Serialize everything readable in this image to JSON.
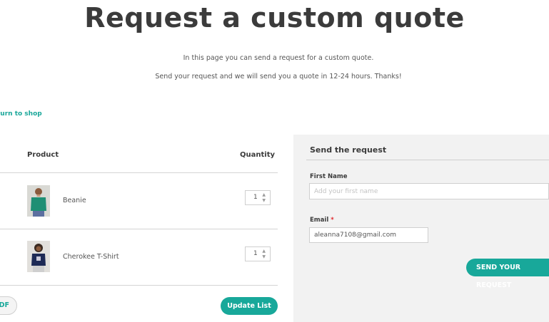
{
  "page": {
    "title": "Request a custom quote",
    "intro_line_1": "In this page you can send a request for a custom quote.",
    "intro_line_2": "Send your request and we will send you a quote in 12-24 hours. Thanks!",
    "return_link": "turn to shop"
  },
  "table": {
    "headers": {
      "product": "Product",
      "quantity": "Quantity"
    },
    "rows": [
      {
        "name": "Beanie",
        "quantity": "1",
        "thumb_icon": "green-shirt-model-image"
      },
      {
        "name": "Cherokee T-Shirt",
        "quantity": "1",
        "thumb_icon": "navy-shirt-model-image"
      }
    ],
    "pdf_button": "DF",
    "update_button": "Update List"
  },
  "form": {
    "title": "Send the request",
    "first_name_label": "First Name",
    "first_name_placeholder": "Add your first name",
    "first_name_value": "",
    "email_label": "Email",
    "email_required_mark": "*",
    "email_value": "aleanna7108@gmail.com",
    "submit_button": "SEND YOUR REQUEST"
  },
  "colors": {
    "accent": "#18a89a",
    "panel_bg": "#f2f2f2",
    "required": "#e0262b"
  }
}
